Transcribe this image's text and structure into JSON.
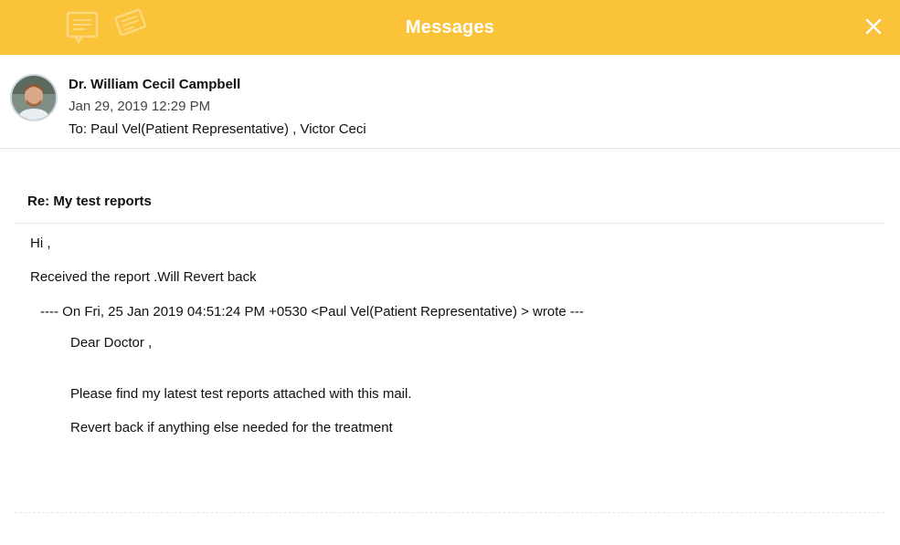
{
  "header": {
    "title": "Messages",
    "close_icon": "close-icon",
    "decorative_icons": [
      "message-icon",
      "compose-icon"
    ],
    "background_color": "#fbc339"
  },
  "sender": {
    "name": "Dr. William Cecil Campbell",
    "date": "Jan 29, 2019 12:29 PM",
    "to": "To: Paul Vel(Patient Representative) , Victor Ceci",
    "avatar_icon": "avatar"
  },
  "message": {
    "subject": "Re: My test reports",
    "greeting": "Hi ,",
    "reply_text": "Received the report .Will Revert back",
    "quote_header": "---- On Fri, 25 Jan 2019 04:51:24 PM +0530 <Paul Vel(Patient Representative) > wrote ---",
    "quoted_lines": [
      "Dear Doctor ,",
      "Please find my latest test reports attached with this mail.",
      "Revert back if anything else needed for the treatment"
    ]
  }
}
